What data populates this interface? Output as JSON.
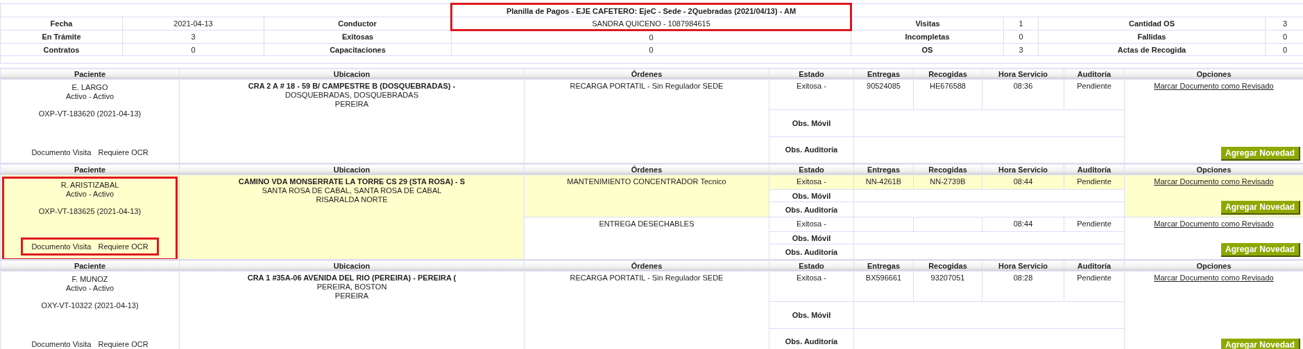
{
  "summary": {
    "title": "Planilla de Pagos - EJE CAFETERO: EjeC - Sede - 2Quebradas (2021/04/13) - AM",
    "outlined": true,
    "rows": [
      [
        {
          "label": "Fecha",
          "value": "2021-04-13"
        },
        {
          "label": "Conductor",
          "value": "SANDRA QUICENO - 1087984615"
        },
        {
          "label": "Visitas",
          "value": "1"
        },
        {
          "label": "Cantidad OS",
          "value": "3"
        }
      ],
      [
        {
          "label": "En Trámite",
          "value": "3"
        },
        {
          "label": "Exitosas",
          "value": "0"
        },
        {
          "label": "Incompletas",
          "value": "0"
        },
        {
          "label": "Fallidas",
          "value": "0"
        }
      ],
      [
        {
          "label": "Contratos",
          "value": "0"
        },
        {
          "label": "Capacitaciones",
          "value": "0"
        },
        {
          "label": "OS",
          "value": "3"
        },
        {
          "label": "Actas de Recogida",
          "value": "0"
        }
      ]
    ]
  },
  "visits": [
    {
      "columns": [
        "Paciente",
        "Ubicacion",
        "Órdenes",
        "Estado",
        "Entregas",
        "Recogidas",
        "Hora Servicio",
        "Auditoría",
        "Opciones"
      ],
      "highlighted": false,
      "outlined": false,
      "docs_outlined": false,
      "patient": {
        "name": "E. LARGO",
        "status": "Activo - Activo",
        "code": "OXP-VT-183620 (2021-04-13)",
        "documents": [
          "Documento Visita",
          "Requiere OCR"
        ]
      },
      "location": [
        "CRA 2 A # 18 - 59 B/ CAMPESTRE B (DOSQUEBRADAS) -",
        "DOSQUEBRADAS, DOSQUEBRADAS",
        "PEREIRA"
      ],
      "orders": [
        {
          "highlighted": false,
          "order": "RECARGA PORTATIL - Sin Regulador SEDE",
          "state": "Exitosa -",
          "deliveries": "90524085",
          "pickups": "HE676588",
          "time": "08:36",
          "audit": "Pendiente",
          "obs_mobile_label": "Obs. Móvil",
          "obs_audit_label": "Obs. Auditoría",
          "link": "Marcar Documento como Revisado",
          "button": "Agregar Novedad"
        }
      ]
    },
    {
      "columns": [
        "Paciente",
        "Ubicacion",
        "Órdenes",
        "Estado",
        "Entregas",
        "Recogidas",
        "Hora Servicio",
        "Auditoría",
        "Opciones"
      ],
      "highlighted": true,
      "outlined": true,
      "docs_outlined": true,
      "patient": {
        "name": "R. ARISTIZABAL",
        "status": "Activo - Activo",
        "code": "OXP-VT-183625 (2021-04-13)",
        "documents": [
          "Documento Visita",
          "Requiere OCR"
        ]
      },
      "location": [
        "CAMINO VDA MONSERRATE LA TORRE CS 29 (STA ROSA) - S",
        "SANTA ROSA DE CABAL, SANTA ROSA DE CABAL",
        "RISARALDA NORTE"
      ],
      "orders": [
        {
          "highlighted": true,
          "order": "MANTENIMIENTO CONCENTRADOR Tecnico",
          "state": "Exitosa -",
          "deliveries": "NN-4261B",
          "pickups": "NN-2739B",
          "time": "08:44",
          "audit": "Pendiente",
          "obs_mobile_label": "Obs. Móvil",
          "obs_audit_label": "Obs. Auditoría",
          "link": "Marcar Documento como Revisado",
          "button": "Agregar Novedad"
        },
        {
          "highlighted": false,
          "order": "ENTREGA DESECHABLES",
          "state": "Exitosa -",
          "time": "08:44",
          "audit": "Pendiente",
          "obs_mobile_label": "Obs. Móvil",
          "obs_audit_label": "Obs. Auditoría",
          "link": "Marcar Documento como Revisado",
          "button": "Agregar Novedad"
        }
      ]
    },
    {
      "columns": [
        "Paciente",
        "Ubicacion",
        "Órdenes",
        "Estado",
        "Entregas",
        "Recogidas",
        "Hora Servicio",
        "Auditoría",
        "Opciones"
      ],
      "highlighted": false,
      "outlined": false,
      "docs_outlined": false,
      "patient": {
        "name": "F. MUNOZ",
        "status": "Activo - Activo",
        "code": "OXY-VT-10322 (2021-04-13)",
        "documents": [
          "Documento Visita",
          "Requiere OCR"
        ]
      },
      "location": [
        "CRA 1 #35A-06 AVENIDA DEL RIO (PEREIRA) - PEREIRA (",
        "PEREIRA, BOSTON",
        "PEREIRA"
      ],
      "orders": [
        {
          "highlighted": false,
          "order": "RECARGA PORTATIL - Sin Regulador SEDE",
          "state": "Exitosa -",
          "deliveries": "BX596661",
          "pickups": "93207051",
          "time": "08:28",
          "audit": "Pendiente",
          "obs_mobile_label": "Obs. Móvil",
          "obs_audit_label": "Obs. Auditoría",
          "link": "Marcar Documento como Revisado",
          "button": "Agregar Novedad"
        }
      ]
    }
  ]
}
